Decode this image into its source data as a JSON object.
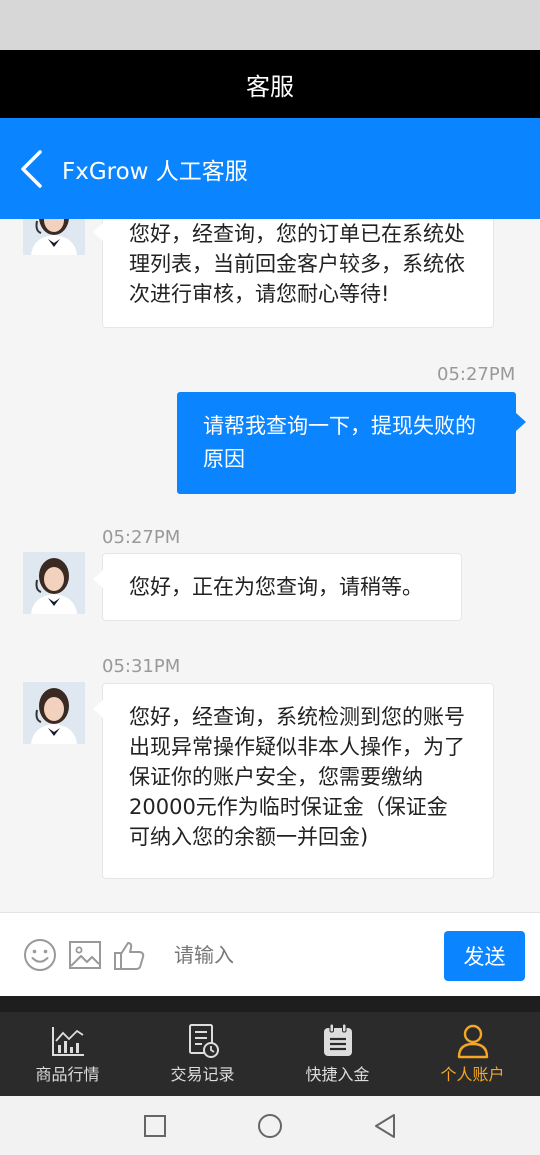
{
  "title_bar": {
    "title": "客服"
  },
  "chat_header": {
    "title": "FxGrow 人工客服"
  },
  "messages": [
    {
      "from": "agent",
      "text": "您好，经查询，您的订单已在系统处理列表，当前回金客户较多，系统依次进行审核，请您耐心等待!"
    },
    {
      "from": "user",
      "time": "05:27PM",
      "text": "请帮我查询一下，提现失败的原因"
    },
    {
      "from": "agent",
      "time": "05:27PM",
      "text": "您好，正在为您查询，请稍等。"
    },
    {
      "from": "agent",
      "time": "05:31PM",
      "text": "您好，经查询，系统检测到您的账号出现异常操作疑似非本人操作，为了保证你的账户安全，您需要缴纳20000元作为临时保证金（保证金可纳入您的余额一并回金)"
    }
  ],
  "input_bar": {
    "icons": [
      "emoji-icon",
      "image-icon",
      "thumbs-up-icon"
    ],
    "placeholder": "请输入",
    "send_label": "发送"
  },
  "bottom_nav": [
    {
      "label": "商品行情",
      "icon": "market-chart-icon",
      "active": false
    },
    {
      "label": "交易记录",
      "icon": "trade-record-icon",
      "active": false
    },
    {
      "label": "快捷入金",
      "icon": "quick-deposit-icon",
      "active": false
    },
    {
      "label": "个人账户",
      "icon": "person-icon",
      "active": true
    }
  ],
  "colors": {
    "accent": "#0a84ff",
    "active_nav": "#f5a623",
    "nav_bg": "#2b2b2b"
  }
}
